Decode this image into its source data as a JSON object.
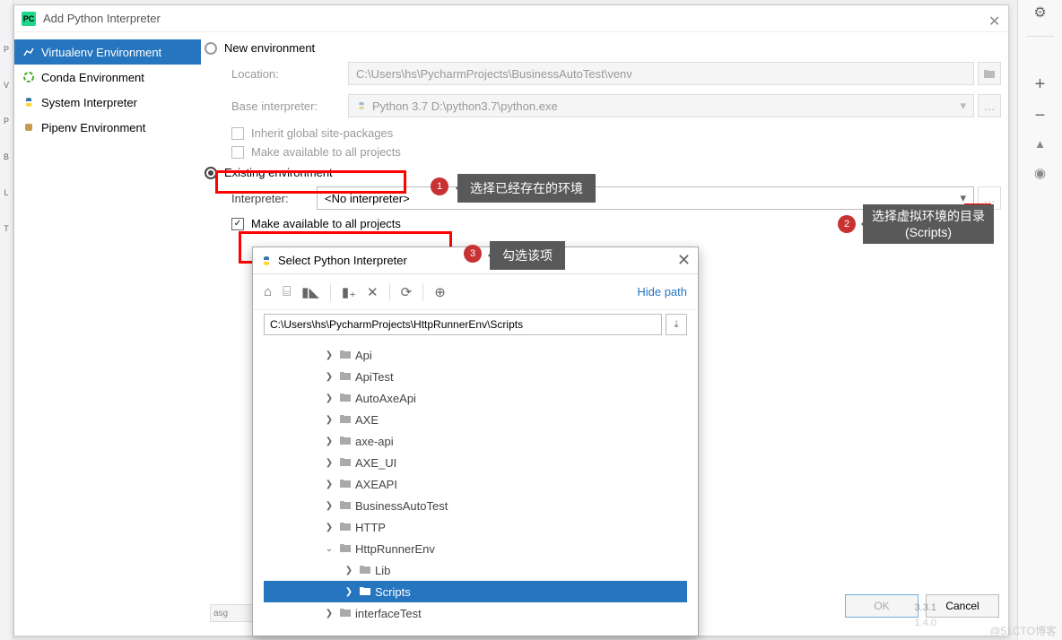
{
  "dialog": {
    "title": "Add Python Interpreter"
  },
  "envs": {
    "virtualenv": "Virtualenv Environment",
    "conda": "Conda Environment",
    "system": "System Interpreter",
    "pipenv": "Pipenv Environment"
  },
  "newEnv": {
    "label": "New environment",
    "locationLabel": "Location:",
    "locationValue": "C:\\Users\\hs\\PycharmProjects\\BusinessAutoTest\\venv",
    "baseInterpLabel": "Base interpreter:",
    "baseInterpValue": "Python 3.7 D:\\python3.7\\python.exe",
    "inherit": "Inherit global site-packages",
    "makeAvail": "Make available to all projects"
  },
  "existing": {
    "label": "Existing environment",
    "interpreterLabel": "Interpreter:",
    "interpreterValue": "<No interpreter>",
    "makeAvail": "Make available to all projects"
  },
  "annotations": {
    "a1": "选择已经存在的环境",
    "a2_line1": "选择虚拟环境的目录",
    "a2_line2": "(Scripts)",
    "a3": "勾选该项"
  },
  "selector": {
    "title": "Select Python Interpreter",
    "hidePath": "Hide path",
    "path": "C:\\Users\\hs\\PycharmProjects\\HttpRunnerEnv\\Scripts",
    "tree": [
      {
        "indent": 3,
        "arrow": ">",
        "label": "Api"
      },
      {
        "indent": 3,
        "arrow": ">",
        "label": "ApiTest"
      },
      {
        "indent": 3,
        "arrow": ">",
        "label": "AutoAxeApi"
      },
      {
        "indent": 3,
        "arrow": ">",
        "label": "AXE"
      },
      {
        "indent": 3,
        "arrow": ">",
        "label": "axe-api"
      },
      {
        "indent": 3,
        "arrow": ">",
        "label": "AXE_UI"
      },
      {
        "indent": 3,
        "arrow": ">",
        "label": "AXEAPI"
      },
      {
        "indent": 3,
        "arrow": ">",
        "label": "BusinessAutoTest"
      },
      {
        "indent": 3,
        "arrow": ">",
        "label": "HTTP"
      },
      {
        "indent": 3,
        "arrow": "v",
        "label": "HttpRunnerEnv"
      },
      {
        "indent": 4,
        "arrow": ">",
        "label": "Lib"
      },
      {
        "indent": 4,
        "arrow": ">",
        "label": "Scripts",
        "selected": true
      },
      {
        "indent": 3,
        "arrow": ">",
        "label": "interfaceTest"
      }
    ]
  },
  "buttons": {
    "ok": "OK",
    "cancel": "Cancel"
  },
  "misc": {
    "ver1": "3.3.1",
    "ver2": "1.4.0"
  },
  "watermark": "@51CTO博客"
}
